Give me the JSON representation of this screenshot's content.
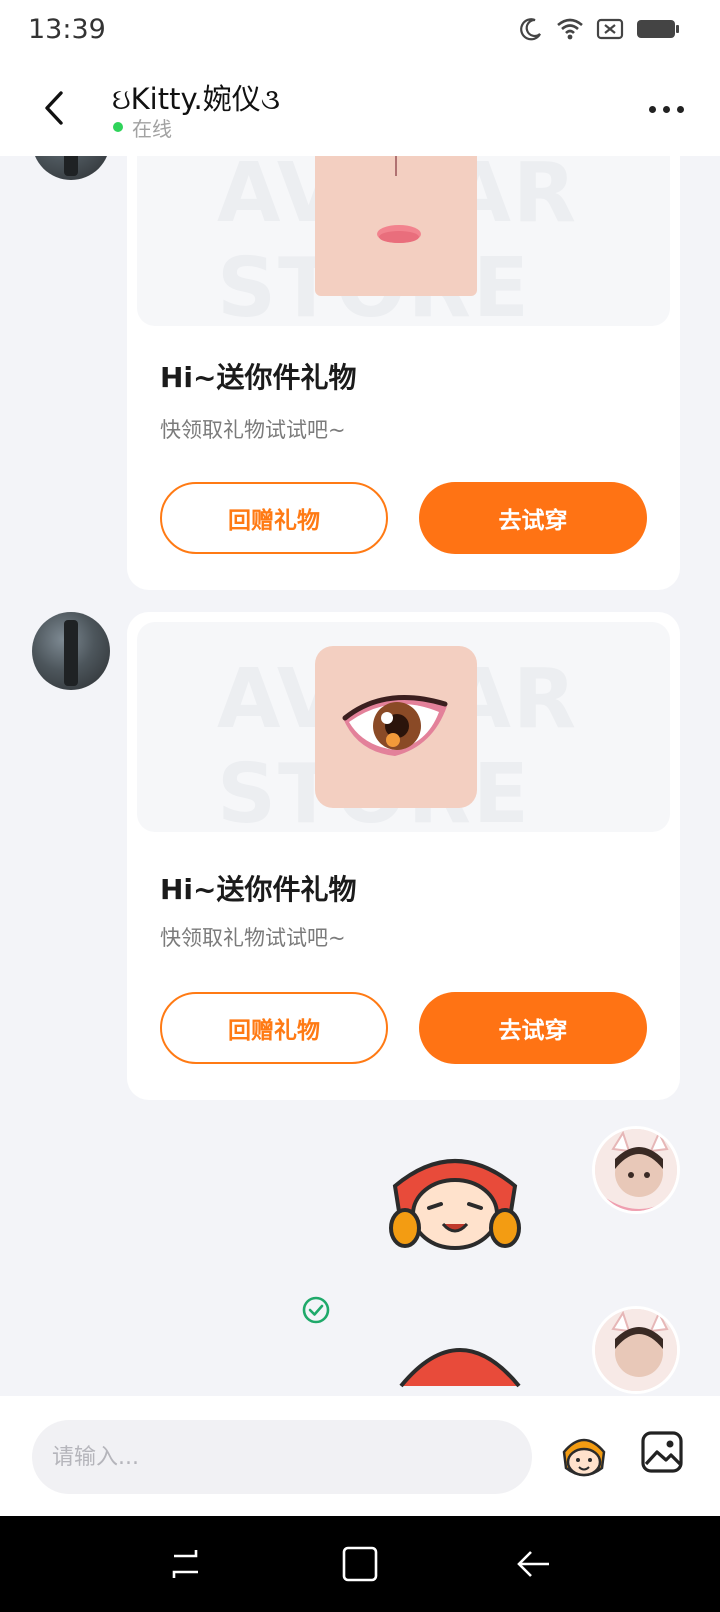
{
  "status_bar": {
    "time": "13:39",
    "icons": [
      "moon-icon",
      "wifi-icon",
      "no-sim-icon",
      "battery-icon"
    ]
  },
  "header": {
    "contact_name": "ઇKitty.婉仪૩",
    "status": "在线",
    "status_color": "#2fd35a"
  },
  "messages": [
    {
      "type": "gift_card",
      "watermark": "AVATAR STORE",
      "title": "Hi~送你件礼物",
      "subtitle": "快领取礼物试试吧~",
      "secondary_button": "回赠礼物",
      "primary_button": "去试穿",
      "gift": "lips"
    },
    {
      "type": "gift_card",
      "watermark": "AVATAR STORE",
      "title": "Hi~送你件礼物",
      "subtitle": "快领取礼物试试吧~",
      "secondary_button": "回赠礼物",
      "primary_button": "去试穿",
      "gift": "eye"
    },
    {
      "type": "sticker",
      "sender": "me",
      "status": "read-check-icon"
    },
    {
      "type": "sticker",
      "sender": "me"
    }
  ],
  "input": {
    "placeholder": "请输入...",
    "emoji_icon": "emoji-sticker-icon",
    "image_icon": "image-icon"
  },
  "nav": [
    "recents-icon",
    "home-icon",
    "back-icon"
  ],
  "colors": {
    "accent": "#ff7314",
    "background": "#f3f4f8"
  }
}
